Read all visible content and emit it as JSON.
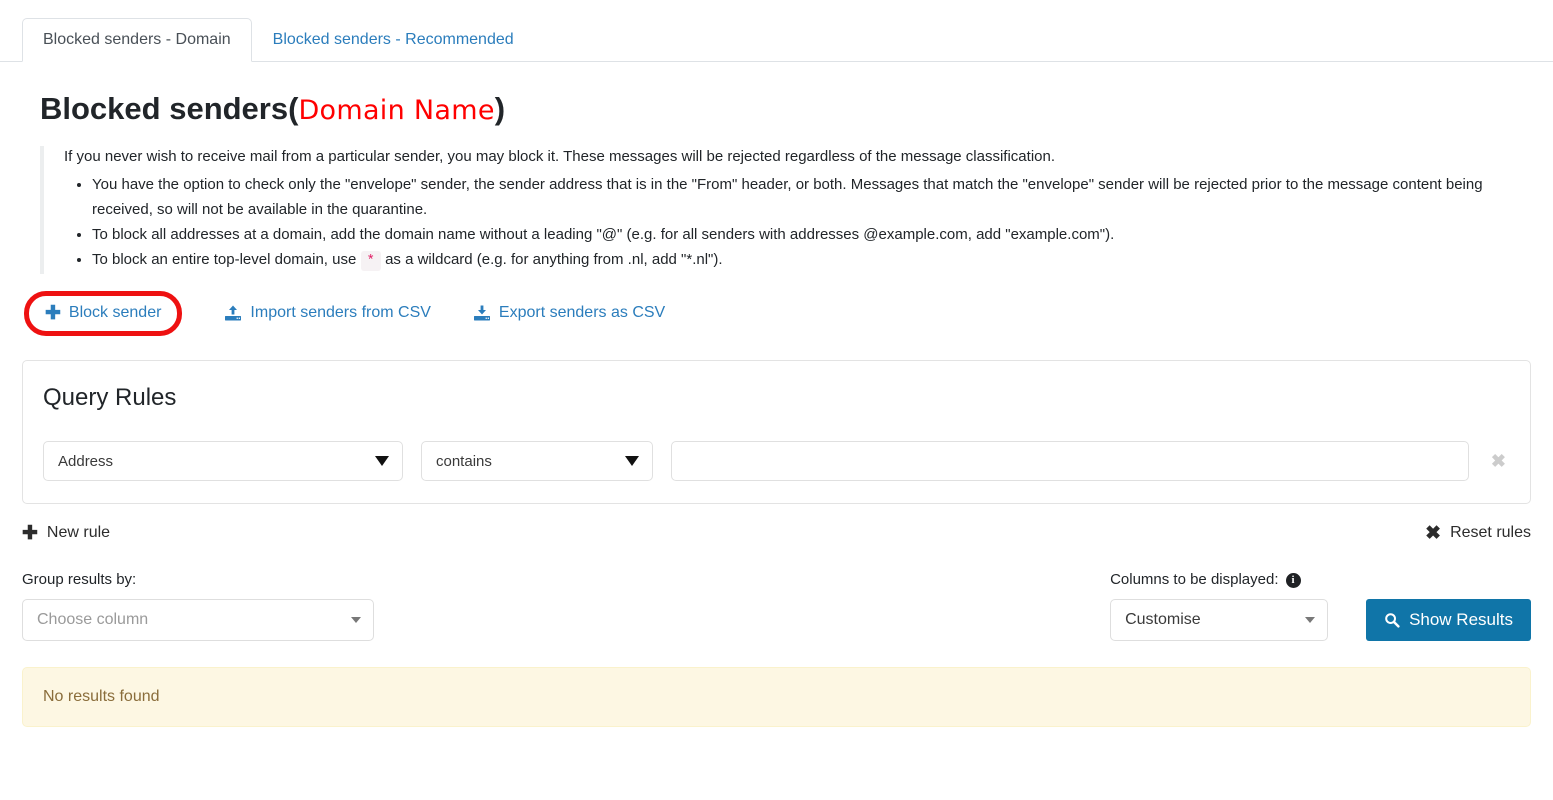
{
  "tabs": [
    {
      "label": "Blocked senders - Domain",
      "active": true
    },
    {
      "label": "Blocked senders - Recommended",
      "active": false
    }
  ],
  "heading": {
    "main": "Blocked senders",
    "paren_open": "(",
    "domain": "Domain Name",
    "paren_close": ")"
  },
  "help": {
    "intro": "If you never wish to receive mail from a particular sender, you may block it. These messages will be rejected regardless of the message classification.",
    "bullets": [
      "You have the option to check only the \"envelope\" sender, the sender address that is in the \"From\" header, or both. Messages that match the \"envelope\" sender will be rejected prior to the message content being received, so will not be available in the quarantine.",
      "To block all addresses at a domain, add the domain name without a leading \"@\" (e.g. for all senders with addresses @example.com, add \"example.com\").",
      "To block an entire top-level domain, use * as a wildcard (e.g. for anything from .nl, add \"*.nl\")."
    ],
    "wildcard_prefix": "To block an entire top-level domain, use",
    "wildcard_code": "*",
    "wildcard_suffix": "as a wildcard (e.g. for anything from .nl, add \"*.nl\")."
  },
  "actions": {
    "block_sender": "Block sender",
    "import_csv": "Import senders from CSV",
    "export_csv": "Export senders as CSV",
    "highlight_color": "#ee1111"
  },
  "query_rules": {
    "title": "Query Rules",
    "field": "Address",
    "operator": "contains",
    "value": "",
    "value_placeholder": "",
    "remove_label": "✖",
    "new_rule": "New rule",
    "reset_rules": "Reset rules"
  },
  "controls": {
    "group_label": "Group results by:",
    "group_value": "Choose column",
    "columns_label": "Columns to be displayed:",
    "columns_value": "Customise",
    "show_results": "Show Results",
    "primary_color": "#1075a8"
  },
  "alert": {
    "message": "No results found"
  }
}
